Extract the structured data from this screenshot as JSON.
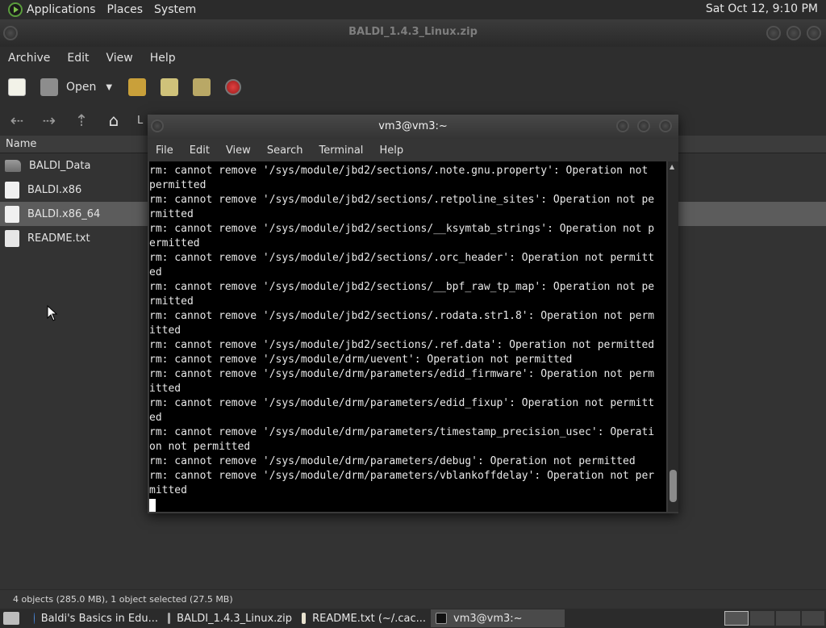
{
  "top_panel": {
    "menus": [
      "Applications",
      "Places",
      "System"
    ],
    "clock": "Sat Oct 12,  9:10 PM"
  },
  "archive_window": {
    "title": "BALDI_1.4.3_Linux.zip",
    "menus": [
      "Archive",
      "Edit",
      "View",
      "Help"
    ],
    "toolbar": {
      "open_label": "Open"
    },
    "location_partial": "L",
    "list_header": "Name",
    "files": [
      {
        "name": "BALDI_Data",
        "icon": "folder-icon"
      },
      {
        "name": "BALDI.x86",
        "icon": "file-icon"
      },
      {
        "name": "BALDI.x86_64",
        "icon": "file-icon",
        "selected": true
      },
      {
        "name": "README.txt",
        "icon": "text-file-icon"
      }
    ],
    "status": "4 objects (285.0 MB), 1 object selected (27.5 MB)"
  },
  "terminal_window": {
    "title": "vm3@vm3:~",
    "menus": [
      "File",
      "Edit",
      "View",
      "Search",
      "Terminal",
      "Help"
    ],
    "lines": [
      "rm: cannot remove '/sys/module/jbd2/sections/.note.gnu.property': Operation not",
      "permitted",
      "rm: cannot remove '/sys/module/jbd2/sections/.retpoline_sites': Operation not pe",
      "rmitted",
      "rm: cannot remove '/sys/module/jbd2/sections/__ksymtab_strings': Operation not p",
      "ermitted",
      "rm: cannot remove '/sys/module/jbd2/sections/.orc_header': Operation not permitt",
      "ed",
      "rm: cannot remove '/sys/module/jbd2/sections/__bpf_raw_tp_map': Operation not pe",
      "rmitted",
      "rm: cannot remove '/sys/module/jbd2/sections/.rodata.str1.8': Operation not perm",
      "itted",
      "rm: cannot remove '/sys/module/jbd2/sections/.ref.data': Operation not permitted",
      "rm: cannot remove '/sys/module/drm/uevent': Operation not permitted",
      "rm: cannot remove '/sys/module/drm/parameters/edid_firmware': Operation not perm",
      "itted",
      "rm: cannot remove '/sys/module/drm/parameters/edid_fixup': Operation not permitt",
      "ed",
      "rm: cannot remove '/sys/module/drm/parameters/timestamp_precision_usec': Operati",
      "on not permitted",
      "rm: cannot remove '/sys/module/drm/parameters/debug': Operation not permitted",
      "rm: cannot remove '/sys/module/drm/parameters/vblankoffdelay': Operation not per",
      "mitted"
    ]
  },
  "taskbar": {
    "tasks": [
      {
        "label": "Baldi's Basics in Edu...",
        "icon": "browser-icon"
      },
      {
        "label": "BALDI_1.4.3_Linux.zip",
        "icon": "archive-icon"
      },
      {
        "label": "README.txt (~/.cac...",
        "icon": "text-editor-icon"
      },
      {
        "label": "vm3@vm3:~",
        "icon": "terminal-icon",
        "active": true
      }
    ]
  },
  "colors": {
    "panel": "#2b2b2b",
    "window_bg": "#333333",
    "selection": "#5c5c5c",
    "terminal_bg": "#000000",
    "terminal_fg": "#e8e8e8",
    "stop_red": "#c62828"
  }
}
